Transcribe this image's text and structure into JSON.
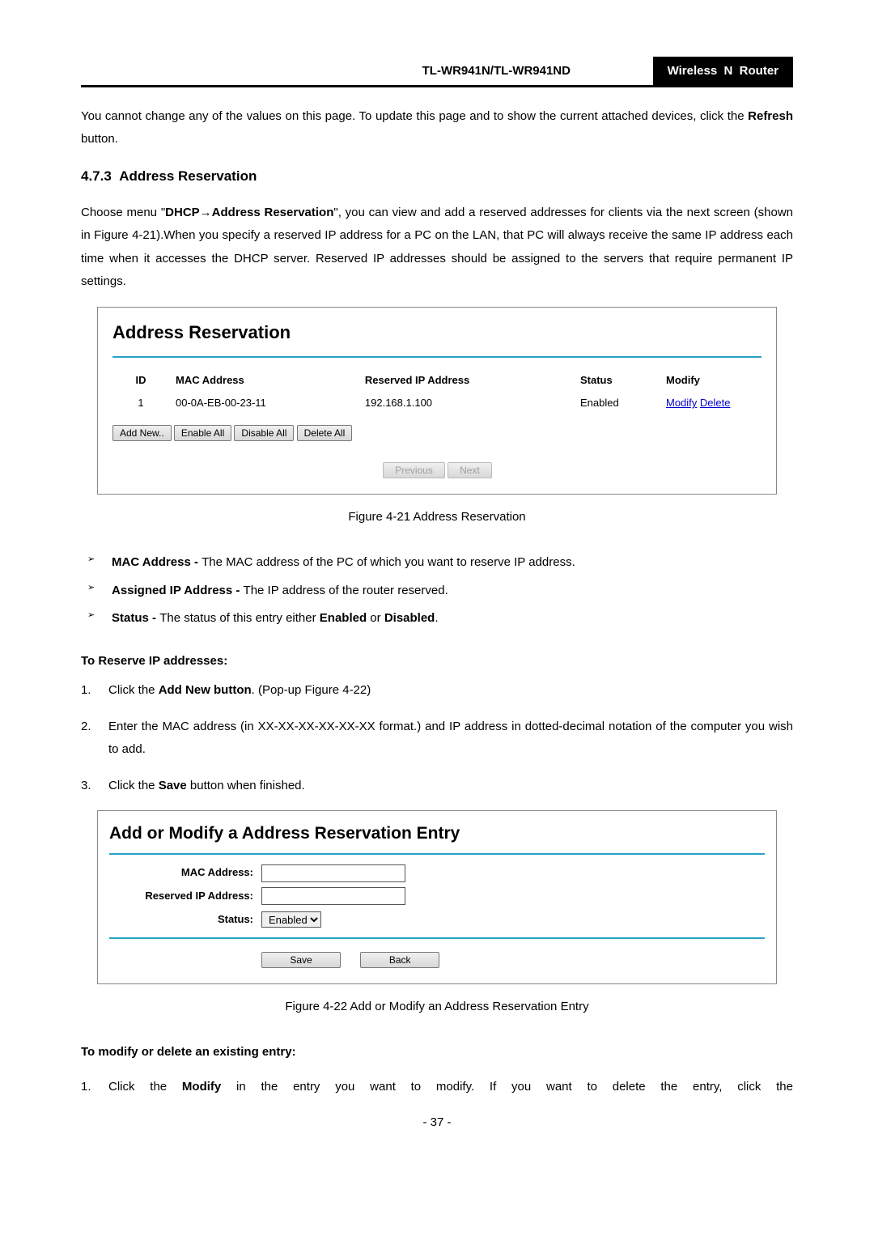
{
  "header": {
    "model": "TL-WR941N/TL-WR941ND",
    "product": "Wireless  N  Router"
  },
  "intro_part1": "You cannot change any of the values on this page. To update this page and to show the current attached devices, click the ",
  "intro_bold": "Refresh",
  "intro_part2": " button.",
  "section_number": "4.7.3",
  "section_title": "Address Reservation",
  "para1": {
    "p1": "Choose menu \"",
    "b1": "DHCP",
    "arrow": "→",
    "b2": "Address Reservation",
    "p2": "\", you can view and add a reserved addresses for clients via the next screen (shown in Figure 4-21).When you specify a reserved IP address for a PC on the LAN, that PC will always receive the same IP address each time when it accesses the DHCP server. Reserved IP addresses should be assigned to the servers that require permanent IP settings."
  },
  "fig21": {
    "title": "Address Reservation",
    "cols": {
      "id": "ID",
      "mac": "MAC Address",
      "ip": "Reserved IP Address",
      "status": "Status",
      "modify": "Modify"
    },
    "row": {
      "id": "1",
      "mac": "00-0A-EB-00-23-11",
      "ip": "192.168.1.100",
      "status": "Enabled",
      "link_modify": "Modify",
      "link_delete": "Delete"
    },
    "buttons": {
      "add": "Add New..",
      "enable": "Enable All",
      "disable": "Disable All",
      "delete": "Delete All"
    },
    "nav": {
      "prev": "Previous",
      "next": "Next"
    }
  },
  "fig21_caption": "Figure 4-21    Address Reservation",
  "bullets": [
    {
      "b": "MAC Address - ",
      "t": "The MAC address of the PC of which you want to reserve IP address."
    },
    {
      "b": "Assigned IP Address - ",
      "t": "The IP address of the router reserved."
    },
    {
      "b": "Status - ",
      "t_p1": "The status of this entry either ",
      "t_b1": "Enabled",
      "t_p2": " or ",
      "t_b2": "Disabled",
      "t_p3": "."
    }
  ],
  "reserve_heading": "To Reserve IP addresses:",
  "steps": [
    {
      "n": "1.",
      "p1": "Click the ",
      "b1": "Add New button",
      "p2": ". (Pop-up Figure 4-22)"
    },
    {
      "n": "2.",
      "p1": "Enter the MAC address (in XX-XX-XX-XX-XX-XX format.) and IP address in dotted-decimal notation of the computer you wish to add."
    },
    {
      "n": "3.",
      "p1": "Click the ",
      "b1": "Save",
      "p2": " button when finished."
    }
  ],
  "fig22": {
    "title": "Add or Modify a Address Reservation Entry",
    "labels": {
      "mac": "MAC Address:",
      "ip": "Reserved IP Address:",
      "status": "Status:"
    },
    "status_value": "Enabled",
    "buttons": {
      "save": "Save",
      "back": "Back"
    }
  },
  "fig22_caption": "Figure 4-22    Add or Modify an Address Reservation Entry",
  "modify_heading": "To modify or delete an existing entry:",
  "modify_step": {
    "n": "1.",
    "p1": "Click the ",
    "b1": "Modify",
    "p2": " in the entry you want to modify. If you want to delete the entry, click the"
  },
  "page_number": "- 37 -"
}
